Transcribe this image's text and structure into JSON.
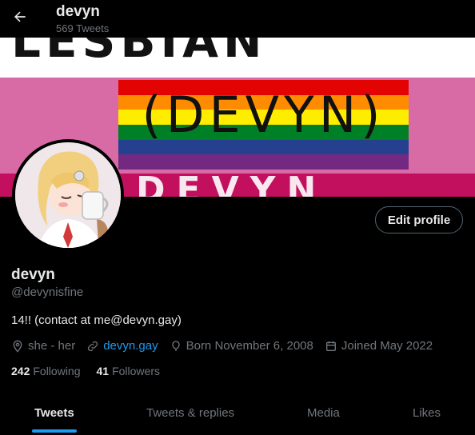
{
  "header": {
    "name": "devyn",
    "tweet_count": "569 Tweets"
  },
  "banner": {
    "graffiti_text": "LESBIAN",
    "flag_text": "(DEVYN)",
    "bottom_text": "DEVYN"
  },
  "profile": {
    "name": "devyn",
    "handle": "@devynisfine",
    "bio": "14!! (contact at me@devyn.gay)",
    "edit_label": "Edit profile",
    "pronouns": "she - her",
    "website": "devyn.gay",
    "born": "Born November 6, 2008",
    "joined": "Joined May 2022",
    "following_count": "242",
    "following_label": "Following",
    "followers_count": "41",
    "followers_label": "Followers"
  },
  "tabs": [
    "Tweets",
    "Tweets & replies",
    "Media",
    "Likes"
  ],
  "colors": {
    "accent": "#1d9bf0",
    "muted": "#71767b",
    "text": "#e7e9ea"
  }
}
